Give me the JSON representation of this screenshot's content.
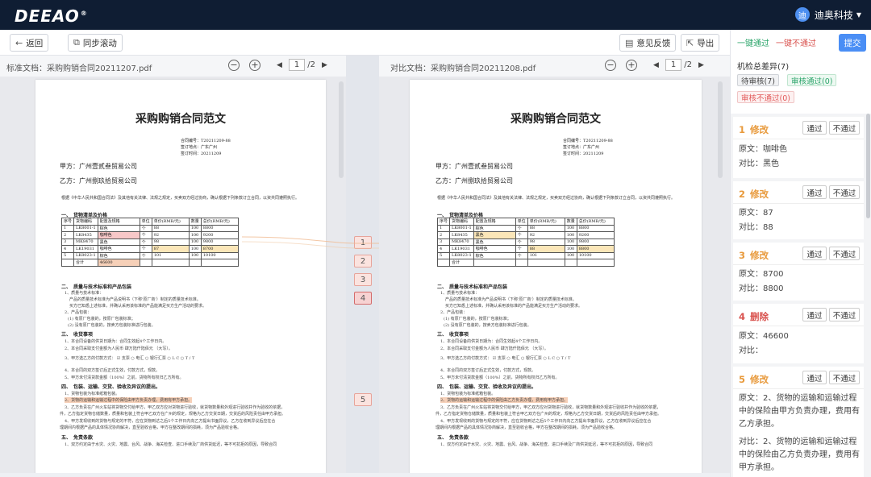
{
  "app": {
    "logo": "DEEAO",
    "logo_mark": "®",
    "user_avatar": "迪",
    "user_name": "迪奥科技"
  },
  "toolbar": {
    "back": "返回",
    "sync_scroll": "同步滚动",
    "feedback": "意见反馈",
    "export": "导出"
  },
  "left_doc": {
    "label": "标准文档：采购购销合同20211207.pdf",
    "page": "1",
    "total": "/2"
  },
  "right_doc": {
    "label": "对比文档：采购购销合同20211208.pdf",
    "page": "1",
    "total": "/2"
  },
  "contract": {
    "title": "采购购销合同范文",
    "meta": [
      "合同编号：T20211209-88",
      "签订地点：广东广州",
      "签订时间：20211209"
    ],
    "party_a": "甲方：广州壹贰叁贸易公司",
    "party_b": "乙方：广州捌玖拾贸易公司",
    "intro": "根据《中华人民共和国合同法》及其他有关法律、法规之规定，买卖双方经过协商，确认根据下列条款订立合同，以资共同遵照执行。",
    "sec1": "一、　货物清单及价格",
    "table_head": [
      "序号",
      "货物编码",
      "配置及规格",
      "单位",
      "单价(RMB/元)",
      "数量",
      "总价(RMB/元)"
    ],
    "left_rows": [
      [
        "1",
        "LK8001-1",
        "棕色",
        "个",
        "88",
        "100",
        "8800"
      ],
      [
        "2",
        "LK8435",
        "咖啡色",
        "个",
        "92",
        "100",
        "9200"
      ],
      [
        "3",
        "MK8470",
        "黑色",
        "个",
        "98",
        "100",
        "9800"
      ],
      [
        "4",
        "LK19031",
        "咖啡色",
        "个",
        "87",
        "100",
        "8700"
      ],
      [
        "5",
        "LK8023-1",
        "棕色",
        "个",
        "101",
        "100",
        "10100"
      ],
      [
        "",
        "合计",
        "46600",
        "",
        "",
        "",
        ""
      ]
    ],
    "right_rows": [
      [
        "1",
        "LK8001-1",
        "棕色",
        "个",
        "88",
        "100",
        "8800"
      ],
      [
        "2",
        "LK8435",
        "黑色",
        "个",
        "92",
        "100",
        "9200"
      ],
      [
        "3",
        "MK8470",
        "黑色",
        "个",
        "98",
        "100",
        "9800"
      ],
      [
        "4",
        "LK19031",
        "咖啡色",
        "个",
        "88",
        "100",
        "8800"
      ],
      [
        "5",
        "LK8023-1",
        "棕色",
        "个",
        "101",
        "100",
        "10100"
      ],
      [
        "",
        "合计",
        "",
        "",
        "",
        "",
        ""
      ]
    ],
    "sec2": "二、　质量与技术标准和产品包装",
    "sec2_lines": [
      "1、质量与技术标准：",
      "产品的质量技术标准为产品说明书（下称'原厂商'）制定的质量技术标准。",
      "买方已知悉上述标准，并确认采用该标准的产品能满足买方生产活动的要求。",
      "2、产品包装：",
      "(1) 有原厂包装的，按原厂包装标准；",
      "(2) 没有原厂包装的，按卖方包装标准进行包装。"
    ],
    "sec3": "三、　收货事项",
    "sec3_lines": [
      "1、本合同设备的供货日期为：合同生效起4个工作日内。",
      "2、本合同采取支付金额为人民币 肆万陆仟陆佰元 （大写）。",
      "3、甲方选乙方的付款方式：  ☑ 支票  ○ 电汇  ○ 银行汇票  ○ L C  ○ T / T",
      "4、本合同的双方签订后正式生效，付款方式，现款。",
      "5、甲方未付清货款金额（100%）之前，货物所有权归乙方所有。"
    ],
    "sec4": "四、　包装、运输、交货、验收及异议的提出。",
    "sec4_lines": [
      "1、货物包装为标准纸箱包装。",
      "2、货物的运输和运输过程中的保险由甲方负责办理，费用有甲方承担。",
      "3、乙方负责在广州火车站将货物交付给甲方，甲乙双方应对货物进行验收，就货物数量和外观进行验收并作为验收的依据，",
      "件，乙方指定货物仓储数量，质量和包装上符合甲乙双方在广州的规定，规格为乙方交货日期，交货后的风险责任由甲方承担。",
      "4、甲方发现收到的货物与规定的不符，应在货物到达之后5个工作日内向乙方提出书面异议，乙方在收到异议后应在合",
      "理期间内根据产品的具体情况协商解决，直至验收合格，甲方在整改期间的损耗，须为产品验收合格。"
    ],
    "sec5": "五、　免责条款",
    "sec5_lines": [
      "1、双方约定由于水灾、火灾、地震、台风、战争、海关检查、进口手续及厂商供货延迟，等不可抗拒的原因，导致合同"
    ]
  },
  "markers": [
    "1",
    "2",
    "3",
    "4",
    "5"
  ],
  "panel": {
    "pass_all": "一键通过",
    "reject_all": "一键不通过",
    "submit": "提交",
    "summary": "机检总差异(7)",
    "tags": {
      "pending": "待审核(7)",
      "approved": "审核通过(0)",
      "rejected": "审核不通过(0)"
    },
    "pass_label": "通过",
    "reject_label": "不通过",
    "orig_prefix": "原文：",
    "comp_prefix": "对比：",
    "diffs": [
      {
        "num": "1",
        "type": "修改",
        "orig": "咖啡色",
        "comp": "黑色"
      },
      {
        "num": "2",
        "type": "修改",
        "orig": "87",
        "comp": "88"
      },
      {
        "num": "3",
        "type": "修改",
        "orig": "8700",
        "comp": "8800"
      },
      {
        "num": "4",
        "type": "删除",
        "orig": "46600",
        "comp": ""
      },
      {
        "num": "5",
        "type": "修改",
        "orig": "2、货物的运输和运输过程中的保险由甲方负责办理，费用有乙方承担。",
        "comp": "2、货物的运输和运输过程中的保险由乙方负责办理，费用有甲方承担。"
      }
    ]
  },
  "colors": {
    "topbar": "#0f1d33",
    "accent": "#4a8ef5",
    "modify": "#e89a3c",
    "delete": "#d9534f",
    "approved": "#2aa46a"
  }
}
